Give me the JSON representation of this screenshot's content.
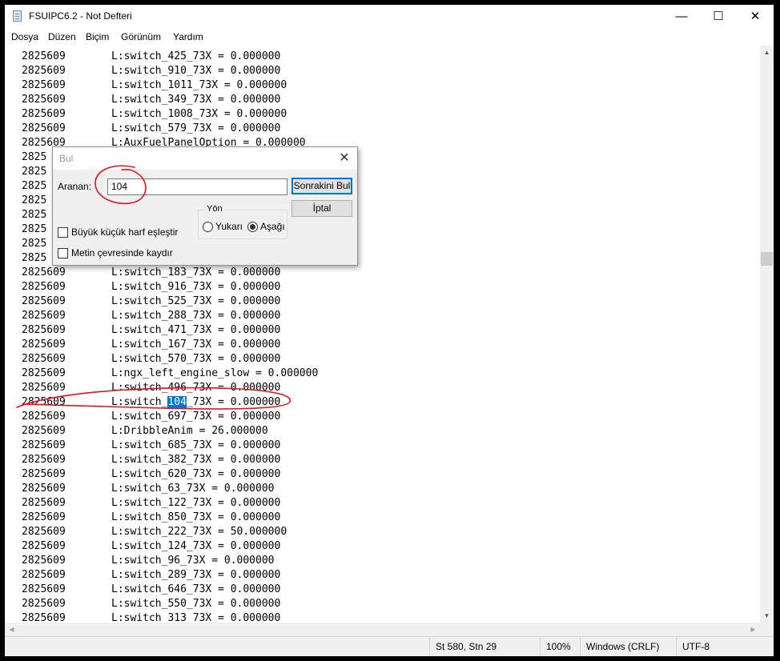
{
  "window": {
    "title": "FSUIPC6.2 - Not Defteri",
    "icons": {
      "app": "notepad-icon",
      "minimize": "minimize-icon",
      "maximize": "maximize-icon",
      "close": "close-icon"
    },
    "minimize_glyph": "—",
    "maximize_glyph": "☐",
    "close_glyph": "✕"
  },
  "menu": [
    "Dosya",
    "Düzen",
    "Biçim",
    "Görünüm",
    "Yardım"
  ],
  "editor": {
    "lines": [
      [
        "2825609",
        "L:switch_425_73X = 0.000000"
      ],
      [
        "2825609",
        "L:switch_910_73X = 0.000000"
      ],
      [
        "2825609",
        "L:switch_1011_73X = 0.000000"
      ],
      [
        "2825609",
        "L:switch_349_73X = 0.000000"
      ],
      [
        "2825609",
        "L:switch_1008_73X = 0.000000"
      ],
      [
        "2825609",
        "L:switch_579_73X = 0.000000"
      ],
      [
        "2825609",
        "L:AuxFuelPanelOption = 0.000000"
      ],
      [
        "2825",
        ""
      ],
      [
        "2825",
        ""
      ],
      [
        "2825",
        ""
      ],
      [
        "2825",
        ""
      ],
      [
        "2825",
        ""
      ],
      [
        "2825",
        ""
      ],
      [
        "2825",
        ""
      ],
      [
        "2825",
        ""
      ],
      [
        "2825609",
        "L:switch_183_73X = 0.000000"
      ],
      [
        "2825609",
        "L:switch_916_73X = 0.000000"
      ],
      [
        "2825609",
        "L:switch_525_73X = 0.000000"
      ],
      [
        "2825609",
        "L:switch_288_73X = 0.000000"
      ],
      [
        "2825609",
        "L:switch_471_73X = 0.000000"
      ],
      [
        "2825609",
        "L:switch_167_73X = 0.000000"
      ],
      [
        "2825609",
        "L:switch_570_73X = 0.000000"
      ],
      [
        "2825609",
        "L:ngx_left_engine_slow = 0.000000"
      ],
      [
        "2825609",
        "L:switch_496_73X = 0.000000"
      ],
      [
        "2825609",
        "L:switch_104_73X = 0.000000"
      ],
      [
        "2825609",
        "L:switch_697_73X = 0.000000"
      ],
      [
        "2825609",
        "L:DribbleAnim = 26.000000"
      ],
      [
        "2825609",
        "L:switch_685_73X = 0.000000"
      ],
      [
        "2825609",
        "L:switch_382_73X = 0.000000"
      ],
      [
        "2825609",
        "L:switch_620_73X = 0.000000"
      ],
      [
        "2825609",
        "L:switch_63_73X = 0.000000"
      ],
      [
        "2825609",
        "L:switch_122_73X = 0.000000"
      ],
      [
        "2825609",
        "L:switch_850_73X = 0.000000"
      ],
      [
        "2825609",
        "L:switch_222_73X = 50.000000"
      ],
      [
        "2825609",
        "L:switch_124_73X = 0.000000"
      ],
      [
        "2825609",
        "L:switch_96_73X = 0.000000"
      ],
      [
        "2825609",
        "L:switch_289_73X = 0.000000"
      ],
      [
        "2825609",
        "L:switch_646_73X = 0.000000"
      ],
      [
        "2825609",
        "L:switch_550_73X = 0.000000"
      ],
      [
        "2825609",
        "L:switch_313_73X = 0.000000"
      ]
    ],
    "highlight": {
      "line_index": 24,
      "text": "104",
      "color": "#0078d7"
    }
  },
  "statusbar": {
    "position": "St 580, Stn 29",
    "zoom": "100%",
    "line_ending": "Windows (CRLF)",
    "encoding": "UTF-8"
  },
  "find_dialog": {
    "title": "Bul",
    "search_label": "Aranan:",
    "search_value": "104",
    "find_next_button": "Sonrakini Bul",
    "cancel_button": "İptal",
    "direction_label": "Yön",
    "direction_up": "Yukarı",
    "direction_down": "Aşağı",
    "direction_selected": "down",
    "match_case": "Büyük küçük harf eşleştir",
    "wrap_around": "Metin çevresinde kaydır",
    "close_glyph": "✕"
  },
  "annotation_color": "#e0151b"
}
